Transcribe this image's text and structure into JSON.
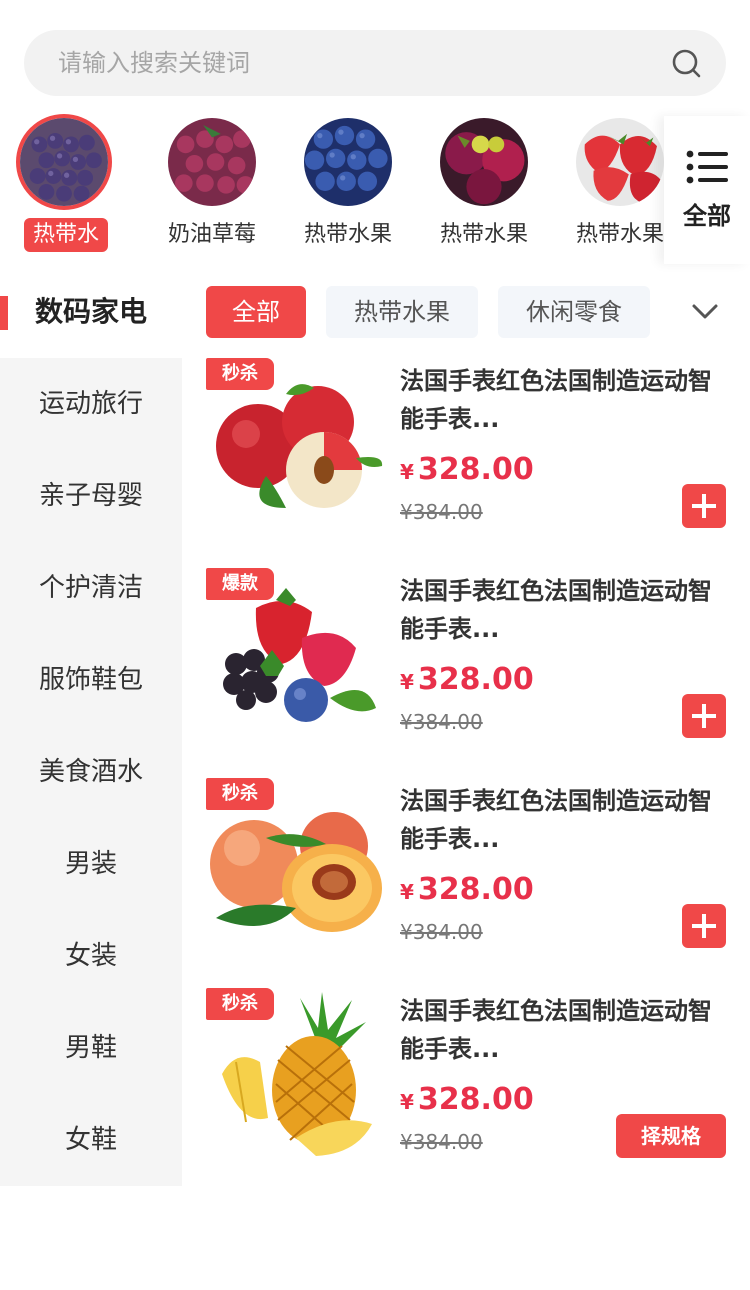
{
  "search": {
    "placeholder": "请输入搜索关键词"
  },
  "categories": [
    {
      "label": "热带水果",
      "active": true
    },
    {
      "label": "奶油草莓",
      "active": false
    },
    {
      "label": "热带水果",
      "active": false
    },
    {
      "label": "热带水果",
      "active": false
    },
    {
      "label": "热带水果",
      "active": false
    }
  ],
  "all_button": {
    "label": "全部"
  },
  "sidebar": {
    "items": [
      {
        "label": "数码家电",
        "active": true
      },
      {
        "label": "运动旅行"
      },
      {
        "label": "亲子母婴"
      },
      {
        "label": "个护清洁"
      },
      {
        "label": "服饰鞋包"
      },
      {
        "label": "美食酒水"
      },
      {
        "label": "男装"
      },
      {
        "label": "女装"
      },
      {
        "label": "男鞋"
      },
      {
        "label": "女鞋"
      }
    ]
  },
  "tabs": [
    {
      "label": "全部",
      "active": true
    },
    {
      "label": "热带水果"
    },
    {
      "label": "休闲零食"
    }
  ],
  "products": [
    {
      "badge": "秒杀",
      "title": "法国手表红色法国制造运动智能手表...",
      "currency": "¥",
      "price": "328.00",
      "old_price": "¥384.00",
      "image": "apple",
      "action": "add"
    },
    {
      "badge": "爆款",
      "title": "法国手表红色法国制造运动智能手表...",
      "currency": "¥",
      "price": "328.00",
      "old_price": "¥384.00",
      "image": "berries",
      "action": "add"
    },
    {
      "badge": "秒杀",
      "title": "法国手表红色法国制造运动智能手表...",
      "currency": "¥",
      "price": "328.00",
      "old_price": "¥384.00",
      "image": "peach",
      "action": "add"
    },
    {
      "badge": "秒杀",
      "title": "法国手表红色法国制造运动智能手表...",
      "currency": "¥",
      "price": "328.00",
      "old_price": "¥384.00",
      "image": "pineapple",
      "action": "spec",
      "action_label": "择规格"
    }
  ],
  "colors": {
    "accent": "#f04848",
    "price": "#e8304a",
    "sidebar_bg": "#f5f5f5"
  }
}
